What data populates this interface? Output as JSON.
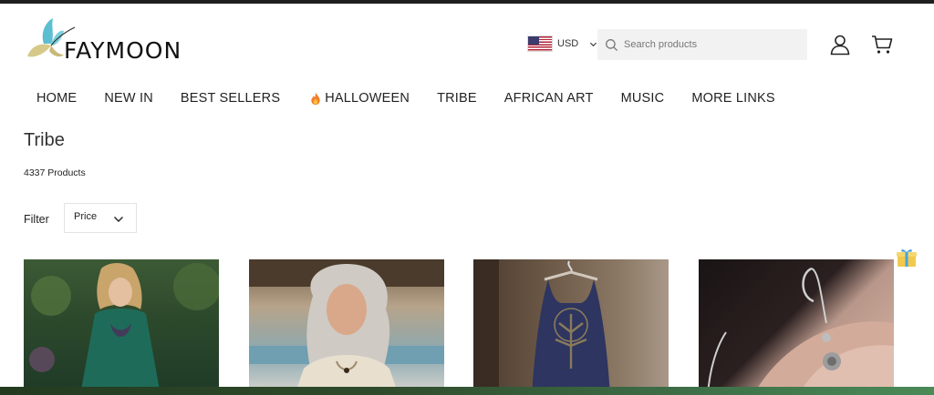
{
  "brand": {
    "name": "FAYMOON"
  },
  "header": {
    "currency_code": "USD",
    "search_placeholder": "Search products"
  },
  "nav": {
    "items": [
      {
        "label": "HOME"
      },
      {
        "label": "NEW IN"
      },
      {
        "label": "BEST SELLERS"
      },
      {
        "label": "HALLOWEEN",
        "icon": "flame-icon"
      },
      {
        "label": "TRIBE"
      },
      {
        "label": "AFRICAN ART"
      },
      {
        "label": "MUSIC"
      },
      {
        "label": "MORE LINKS"
      }
    ]
  },
  "collection": {
    "title": "Tribe",
    "product_count": "4337 Products",
    "filter_label": "Filter",
    "price_filter_label": "Price"
  },
  "colors": {
    "top_bar": "#1f1f1f",
    "logo_teal": "#5bbfd1",
    "logo_beige": "#d6c98a",
    "search_bg": "#f2f2f2",
    "flame": "#f0832a"
  },
  "icons": [
    "search-icon",
    "user-icon",
    "cart-icon",
    "chevron-down-icon",
    "gift-icon",
    "flame-icon",
    "us-flag-icon"
  ]
}
